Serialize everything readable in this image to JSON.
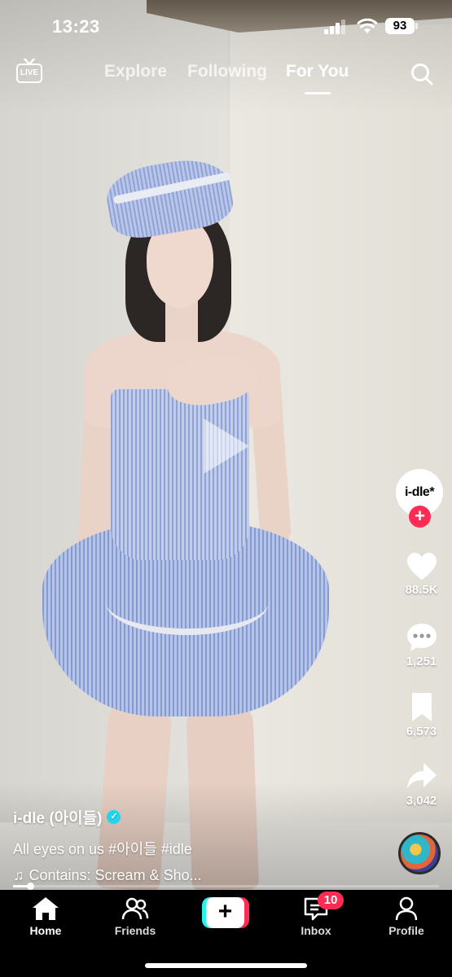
{
  "status_bar": {
    "time": "13:23",
    "battery": "93"
  },
  "top_nav": {
    "live_label": "LIVE",
    "tabs": [
      {
        "label": "Explore",
        "active": false
      },
      {
        "label": "Following",
        "active": false
      },
      {
        "label": "For You",
        "active": true
      }
    ],
    "search_icon": "search-icon"
  },
  "creator": {
    "avatar_text": "i-dle*",
    "username": "i-dle (아이들)",
    "verified": true
  },
  "actions": {
    "likes": "88.5K",
    "comments": "1,251",
    "saves": "6,573",
    "shares": "3,042"
  },
  "caption": {
    "description": "All eyes on us #아이들 #idle",
    "sound": "Contains: Scream & Sho..."
  },
  "video": {
    "progress": 0.04
  },
  "tab_bar": {
    "home": "Home",
    "friends": "Friends",
    "create": "+",
    "inbox": "Inbox",
    "inbox_badge": "10",
    "profile": "Profile"
  },
  "colors": {
    "accent": "#fe2c55",
    "cyan": "#25f4ee",
    "verified": "#20d5ec"
  }
}
